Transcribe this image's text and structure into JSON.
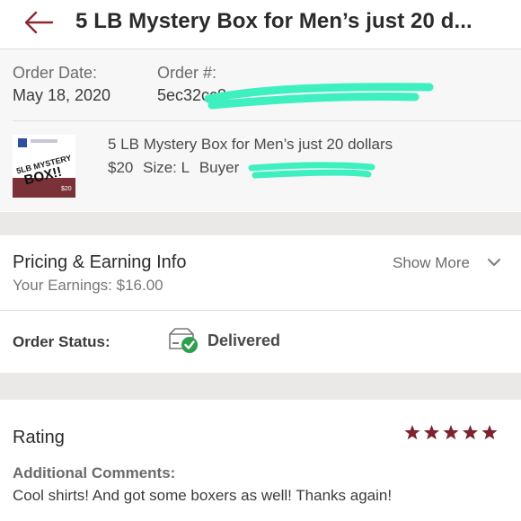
{
  "header": {
    "title": "5 LB Mystery Box for Men’s just 20 d...",
    "back_icon": "back-arrow-icon",
    "accent_color": "#8a2a32"
  },
  "order": {
    "date_label": "Order Date:",
    "date_value": "May 18, 2020",
    "number_label": "Order #:",
    "number_value": "5ec32cc8"
  },
  "item": {
    "title": "5 LB Mystery Box for Men’s just 20 dollars",
    "price": "$20",
    "size": "Size: L",
    "buyer_label": "Buyer",
    "thumbnail_text": "5LB MYSTERY BOX!!",
    "thumbnail_price": "$20"
  },
  "pricing": {
    "title": "Pricing & Earning Info",
    "earnings": "Your Earnings: $16.00",
    "show_more": "Show More",
    "chevron_icon": "chevron-down-icon"
  },
  "status": {
    "label": "Order Status:",
    "value": "Delivered",
    "icon": "package-delivered-icon",
    "check_color": "#2e9e4f"
  },
  "rating": {
    "title": "Rating",
    "stars": 5,
    "star_color": "#7d2330",
    "comments_label": "Additional Comments:",
    "comments": "Cool shirts! And got some boxers as well! Thanks again!"
  },
  "redaction_color": "#3ef0c0"
}
